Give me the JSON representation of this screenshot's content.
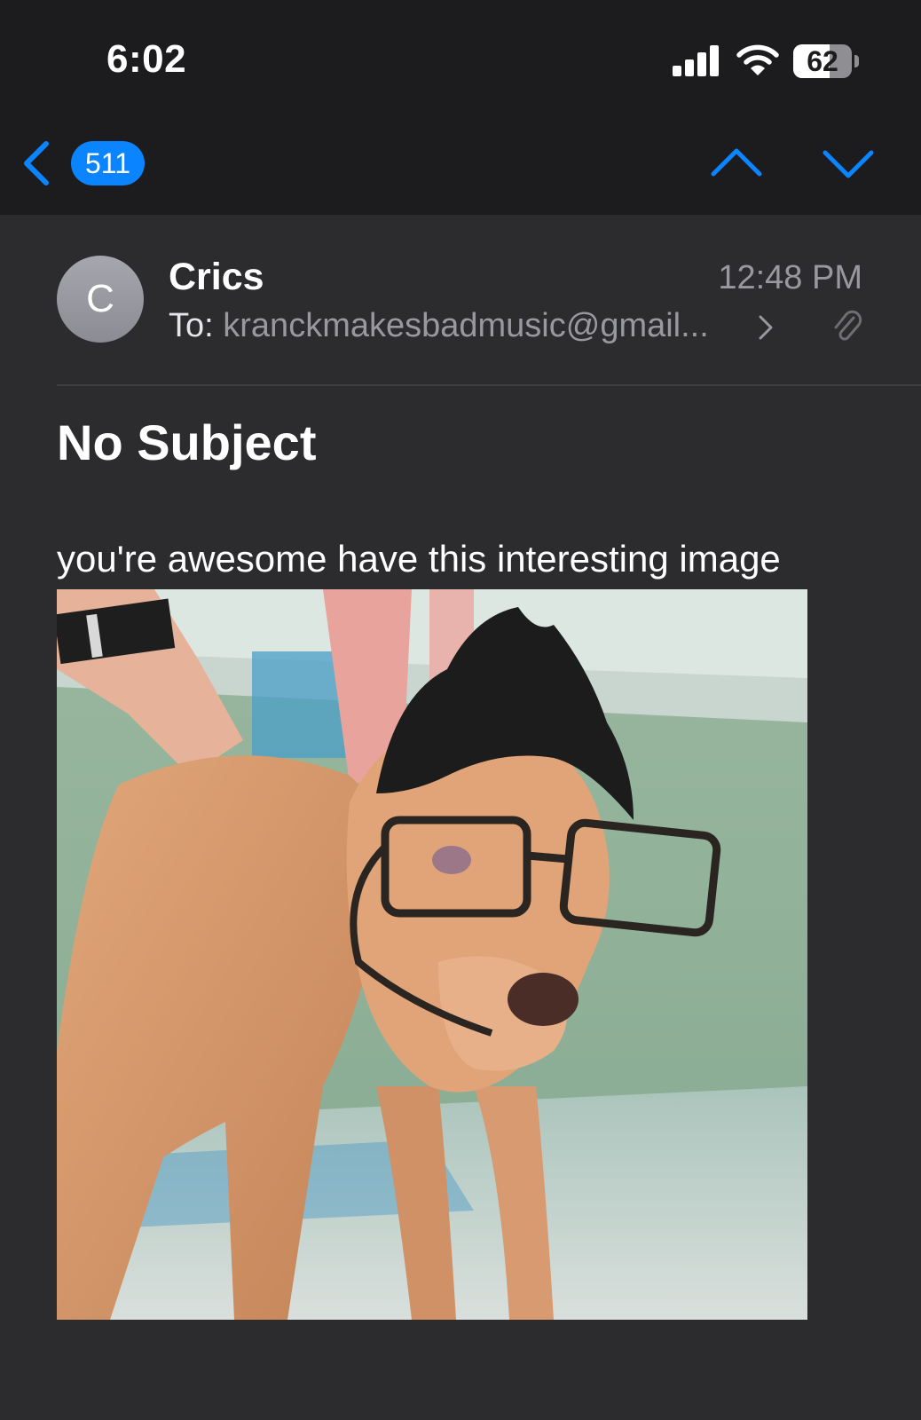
{
  "status_bar": {
    "time": "6:02",
    "battery": "62",
    "battery_level": 0.62
  },
  "nav": {
    "unread_count": "511"
  },
  "message": {
    "avatar_initial": "C",
    "sender": "Crics",
    "time": "12:48 PM",
    "to_label": "To:",
    "to_address": "kranckmakesbadmusic@gmail...",
    "subject": "No Subject",
    "body": "you're awesome have this interesting image"
  },
  "colors": {
    "accent": "#0a84ff",
    "background": "#2c2c2e",
    "header_background": "#1c1c1e",
    "secondary_text": "#98989f"
  },
  "icons": {
    "back": "chevron-left-icon",
    "up": "chevron-up-icon",
    "down": "chevron-down-icon",
    "attachment": "paperclip-icon"
  }
}
